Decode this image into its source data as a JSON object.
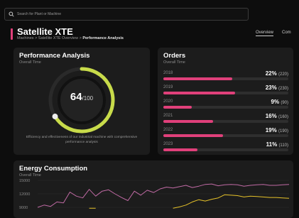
{
  "search": {
    "placeholder": "Search for Plant or Machine",
    "icon": "search-icon"
  },
  "header": {
    "title": "Satellite XTE",
    "breadcrumb": {
      "parts": "Machines > Satellite XTE Overview > ",
      "current": "Performance Analysis"
    },
    "accent": "#e0407a"
  },
  "tabs": [
    {
      "label": "Overview",
      "active": true
    },
    {
      "label": "Com",
      "active": false
    }
  ],
  "performance": {
    "title": "Performance Analysis",
    "subtitle": "Overall Time",
    "score": "64",
    "score_max": "/100",
    "value": 0.64,
    "description": "Efficiency and effectiveness of our industrial machine with comprehensive performance analysis",
    "gauge_color": "#c8db4a"
  },
  "orders": {
    "title": "Orders",
    "subtitle": "Overall Time",
    "bar_color": "#e0407a",
    "rows": [
      {
        "year": "2018",
        "pct": "22%",
        "count": "(220)",
        "value": 0.22
      },
      {
        "year": "2019",
        "pct": "23%",
        "count": "(230)",
        "value": 0.23
      },
      {
        "year": "2020",
        "pct": "9%",
        "count": "(90)",
        "value": 0.09
      },
      {
        "year": "2021",
        "pct": "16%",
        "count": "(160)",
        "value": 0.16
      },
      {
        "year": "2022",
        "pct": "19%",
        "count": "(190)",
        "value": 0.19
      },
      {
        "year": "2023",
        "pct": "11%",
        "count": "(110)",
        "value": 0.11
      }
    ]
  },
  "energy": {
    "title": "Energy Consumption",
    "subtitle": "Overall Time",
    "ticks": [
      "15000",
      "12000",
      "9000"
    ],
    "ylim": [
      9000,
      15000
    ],
    "series": [
      {
        "color": "#c06aa4",
        "values": [
          9000,
          9500,
          9200,
          10200,
          10000,
          12400,
          11500,
          11100,
          13000,
          11500,
          12600,
          12900,
          12000,
          11200,
          10500,
          12600,
          11700,
          12800,
          12300,
          13100,
          13500,
          13300,
          13600,
          13900,
          13400,
          13700,
          14100,
          14200,
          13800,
          14000,
          14100,
          14000,
          13700,
          13900,
          14000,
          14100,
          13900,
          13900,
          14000,
          14100
        ]
      },
      {
        "color": "#e6c229",
        "values": [
          null,
          null,
          null,
          null,
          null,
          null,
          null,
          null,
          8800,
          8800,
          null,
          null,
          null,
          null,
          null,
          null,
          null,
          null,
          null,
          null,
          null,
          8800,
          9100,
          9500,
          10200,
          10700,
          10400,
          10800,
          11100,
          11800,
          11700,
          11600,
          11300,
          11500,
          11400,
          11300,
          11200,
          11200,
          11100,
          11000
        ]
      }
    ]
  }
}
